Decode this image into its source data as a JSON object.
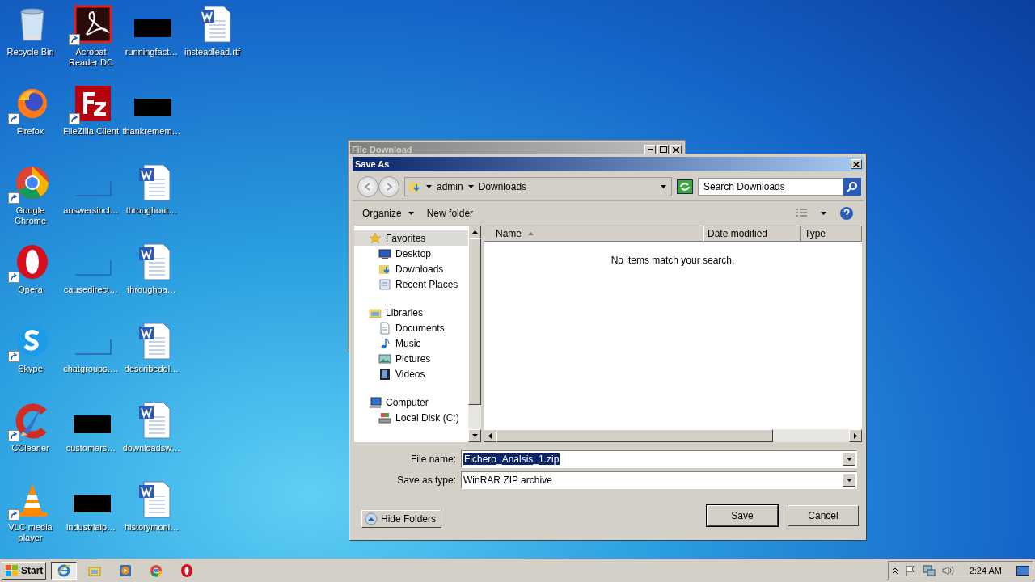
{
  "desktop": {
    "columns": [
      [
        {
          "label": "Recycle Bin",
          "kind": "recycle",
          "shortcut": false
        },
        {
          "label": "Firefox",
          "kind": "firefox",
          "shortcut": true
        },
        {
          "label": "Google Chrome",
          "kind": "chrome",
          "shortcut": true
        },
        {
          "label": "Opera",
          "kind": "opera",
          "shortcut": true
        },
        {
          "label": "Skype",
          "kind": "skype",
          "shortcut": true
        },
        {
          "label": "CCleaner",
          "kind": "ccleaner",
          "shortcut": true
        },
        {
          "label": "VLC media player",
          "kind": "vlc",
          "shortcut": true
        }
      ],
      [
        {
          "label": "Acrobat Reader DC",
          "kind": "acrobat",
          "shortcut": true
        },
        {
          "label": "FileZilla Client",
          "kind": "filezilla",
          "shortcut": true
        },
        {
          "label": "answersincl…",
          "kind": "blank",
          "shortcut": false
        },
        {
          "label": "causedirect…",
          "kind": "blank",
          "shortcut": false
        },
        {
          "label": "chatgroups.…",
          "kind": "blank",
          "shortcut": false
        },
        {
          "label": "customers…",
          "kind": "redacted",
          "shortcut": false
        },
        {
          "label": "industrialp…",
          "kind": "redacted",
          "shortcut": false
        }
      ],
      [
        {
          "label": "runningfact…",
          "kind": "redacted",
          "shortcut": false
        },
        {
          "label": "thankremem…",
          "kind": "redacted",
          "shortcut": false
        },
        {
          "label": "throughout…",
          "kind": "word",
          "shortcut": false
        },
        {
          "label": "throughpa…",
          "kind": "word",
          "shortcut": false
        },
        {
          "label": "describedol…",
          "kind": "word",
          "shortcut": false
        },
        {
          "label": "downloadsw…",
          "kind": "word",
          "shortcut": false
        },
        {
          "label": "historymoni…",
          "kind": "word",
          "shortcut": false
        }
      ],
      [
        {
          "label": "insteadlead.rtf",
          "kind": "word",
          "shortcut": false
        }
      ]
    ]
  },
  "background_window": {
    "title": "File Download"
  },
  "save_as": {
    "title": "Save As",
    "breadcrumb": [
      "admin",
      "Downloads"
    ],
    "search": {
      "placeholder": "Search Downloads"
    },
    "toolbar": {
      "organize": "Organize",
      "new_folder": "New folder"
    },
    "navigation": [
      {
        "label": "Favorites",
        "kind": "star",
        "selected": true,
        "children": [
          {
            "label": "Desktop",
            "kind": "desktop",
            "selected": false
          },
          {
            "label": "Downloads",
            "kind": "downloads",
            "selected": false
          },
          {
            "label": "Recent Places",
            "kind": "recent",
            "selected": false
          }
        ]
      },
      {
        "label": "Libraries",
        "kind": "libraries",
        "selected": false,
        "children": [
          {
            "label": "Documents",
            "kind": "documents",
            "selected": false
          },
          {
            "label": "Music",
            "kind": "music",
            "selected": false
          },
          {
            "label": "Pictures",
            "kind": "pictures",
            "selected": false
          },
          {
            "label": "Videos",
            "kind": "videos",
            "selected": false
          }
        ]
      },
      {
        "label": "Computer",
        "kind": "computer",
        "selected": false,
        "children": [
          {
            "label": "Local Disk (C:)",
            "kind": "disk",
            "selected": false
          }
        ]
      }
    ],
    "columns": [
      {
        "label": "Name",
        "sorted": true
      },
      {
        "label": "Date modified",
        "sorted": false
      },
      {
        "label": "Type",
        "sorted": false
      }
    ],
    "empty_message": "No items match your search.",
    "file_name": {
      "label": "File name:",
      "value": "Fichero_Analsis_1.zip"
    },
    "save_as_type": {
      "label": "Save as type:",
      "value": "WinRAR ZIP archive"
    },
    "hide_folders": "Hide Folders",
    "buttons": [
      {
        "label": "Save",
        "default": true
      },
      {
        "label": "Cancel",
        "default": false
      }
    ]
  },
  "taskbar": {
    "start": "Start",
    "pinned": [
      {
        "kind": "ie",
        "selected": true
      },
      {
        "kind": "explorer",
        "selected": false
      },
      {
        "kind": "media",
        "selected": false
      },
      {
        "kind": "chrome",
        "selected": false
      },
      {
        "kind": "opera",
        "selected": false
      }
    ],
    "clock": "2:24 AM"
  }
}
